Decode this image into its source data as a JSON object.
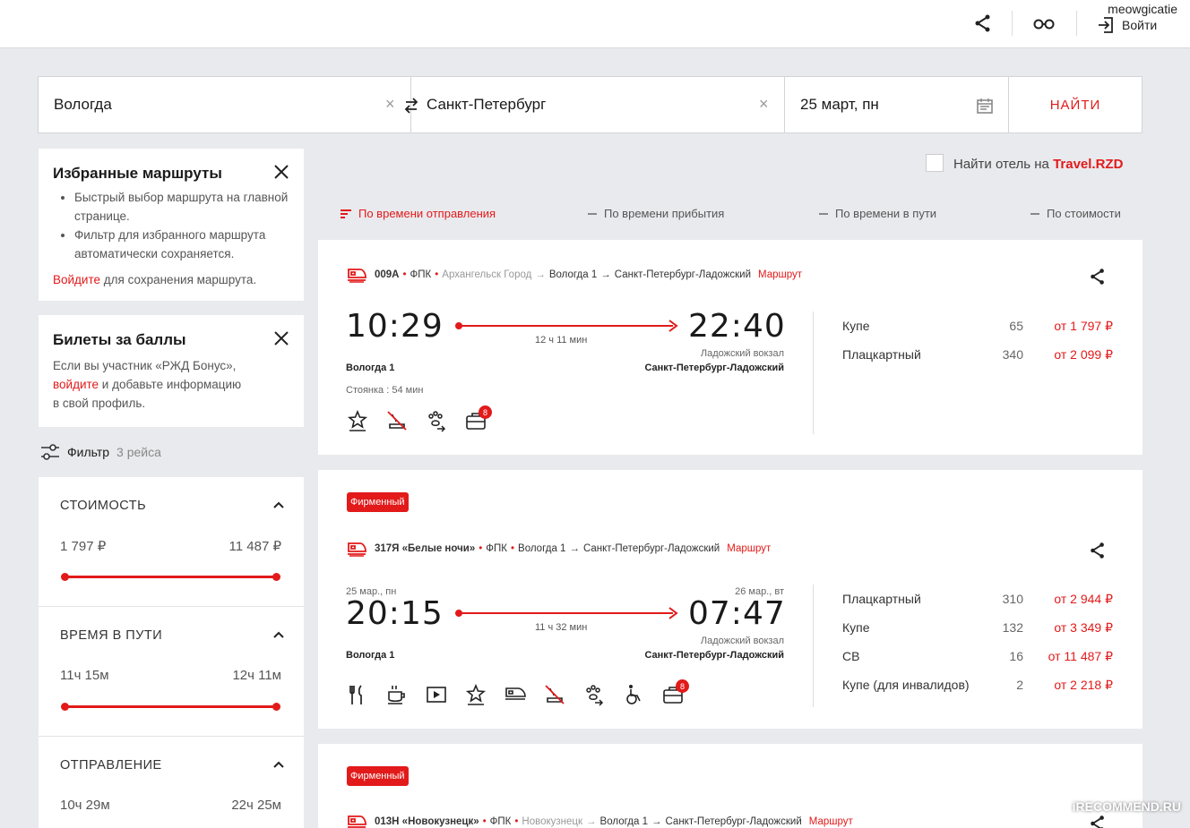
{
  "header": {
    "username": "meowgicatie",
    "login_label": "Войти"
  },
  "search": {
    "from": "Вологда",
    "to": "Санкт-Петербург",
    "date": "25 март, пн",
    "find_label": "НАЙТИ"
  },
  "hotel": {
    "label": "Найти отель на ",
    "link": "Travel.RZD"
  },
  "sort": {
    "items": [
      "По времени отправления",
      "По времени прибытия",
      "По времени в пути",
      "По стоимости"
    ]
  },
  "favorites": {
    "title": "Избранные маршруты",
    "bullets": [
      "Быстрый выбор маршрута на главной странице.",
      "Фильтр для избранного маршрута автоматически сохраняется."
    ],
    "login_link": "Войдите",
    "login_text": " для сохранения маршрута."
  },
  "bonus": {
    "title": "Билеты за баллы",
    "text1": "Если вы участник «РЖД Бонус»,",
    "link": "войдите",
    "text2": " и добавьте информацию",
    "text3": "в свой профиль."
  },
  "filter": {
    "label": "Фильтр",
    "count": "3 рейса",
    "sections": [
      {
        "title": "СТОИМОСТЬ",
        "min": "1 797 ₽",
        "max": "11 487 ₽"
      },
      {
        "title": "ВРЕМЯ В ПУТИ",
        "min": "11ч 15м",
        "max": "12ч 11м"
      },
      {
        "title": "ОТПРАВЛЕНИЕ",
        "min": "10ч 29м",
        "max": "22ч 25м"
      }
    ]
  },
  "trains": [
    {
      "number": "009А",
      "carrier": "ФПК",
      "origin": "Архангельск Город",
      "from": "Вологда 1",
      "to": "Санкт-Петербург-Ладожский",
      "route_link": "Маршрут",
      "dep_time": "10:29",
      "arr_time": "22:40",
      "duration": "12 ч 11 мин",
      "arr_station_note": "Ладожский вокзал",
      "dep_station": "Вологда 1",
      "arr_station": "Санкт-Петербург-Ладожский",
      "stop": "Стоянка : 54 мин",
      "baggage_count": "8",
      "classes": [
        {
          "name": "Купе",
          "seats": "65",
          "price": "от 1 797 ₽"
        },
        {
          "name": "Плацкартный",
          "seats": "340",
          "price": "от 2 099 ₽"
        }
      ]
    },
    {
      "badge": "Фирменный",
      "number": "317Я «Белые ночи»",
      "carrier": "ФПК",
      "from": "Вологда 1",
      "to": "Санкт-Петербург-Ладожский",
      "route_link": "Маршрут",
      "dep_date": "25 мар., пн",
      "arr_date": "26 мар., вт",
      "dep_time": "20:15",
      "arr_time": "07:47",
      "duration": "11 ч 32 мин",
      "arr_station_note": "Ладожский вокзал",
      "dep_station": "Вологда 1",
      "arr_station": "Санкт-Петербург-Ладожский",
      "baggage_count": "8",
      "classes": [
        {
          "name": "Плацкартный",
          "seats": "310",
          "price": "от 2 944 ₽"
        },
        {
          "name": "Купе",
          "seats": "132",
          "price": "от 3 349 ₽"
        },
        {
          "name": "СВ",
          "seats": "16",
          "price": "от 11 487 ₽"
        },
        {
          "name": "Купе (для инвалидов)",
          "seats": "2",
          "price": "от 2 218 ₽"
        }
      ]
    },
    {
      "badge": "Фирменный",
      "number": "013Н «Новокузнецк»",
      "carrier": "ФПК",
      "origin": "Новокузнецк",
      "from": "Вологда 1",
      "to": "Санкт-Петербург-Ладожский",
      "route_link": "Маршрут"
    }
  ],
  "watermark": "iRECOMMEND.RU"
}
